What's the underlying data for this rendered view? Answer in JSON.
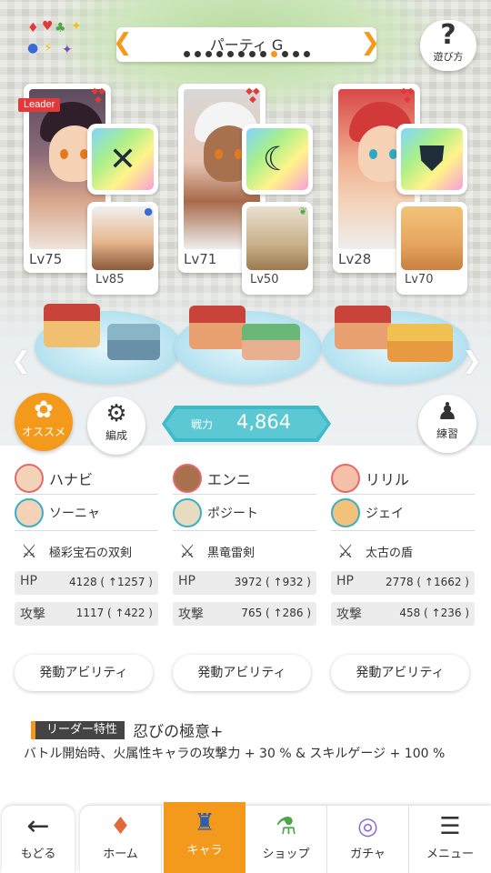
{
  "header": {
    "party_title": "パーティ G",
    "page_dots_total": 12,
    "page_dots_active_index": 8,
    "help_label": "遊び方",
    "suit_icons": [
      "◆",
      "♥",
      "♣",
      "★",
      "●",
      "⚡",
      "✦"
    ]
  },
  "cards": [
    {
      "leader_label": "Leader",
      "main_level": "Lv75",
      "sub_level": "Lv85",
      "weapon_icon": "✕"
    },
    {
      "leader_label": "",
      "main_level": "Lv71",
      "sub_level": "Lv50",
      "weapon_icon": "☾"
    },
    {
      "leader_label": "",
      "main_level": "Lv28",
      "sub_level": "Lv70",
      "weapon_icon": "⛊"
    }
  ],
  "buttons": {
    "recommend_label": "オススメ",
    "formation_label": "編成",
    "practice_label": "練習"
  },
  "power": {
    "label": "戦力",
    "value": "4,864"
  },
  "columns": [
    {
      "main_name": "ハナビ",
      "sub_name": "ソーニャ",
      "weapon_name": "極彩宝石の双剣",
      "hp_label": "HP",
      "hp_value": "4128 ( ↑1257 )",
      "atk_label": "攻撃",
      "atk_value": "1117 ( ↑422 )",
      "ability_label": "発動アビリティ"
    },
    {
      "main_name": "エンニ",
      "sub_name": "ポジート",
      "weapon_name": "黒竜雷剣",
      "hp_label": "HP",
      "hp_value": "3972 ( ↑932 )",
      "atk_label": "攻撃",
      "atk_value": "765 ( ↑286 )",
      "ability_label": "発動アビリティ"
    },
    {
      "main_name": "リリル",
      "sub_name": "ジェイ",
      "weapon_name": "太古の盾",
      "hp_label": "HP",
      "hp_value": "2778 ( ↑1662 )",
      "atk_label": "攻撃",
      "atk_value": "458 ( ↑236 )",
      "ability_label": "発動アビリティ"
    }
  ],
  "leader_skill": {
    "tag": "リーダー特性",
    "name": "忍びの極意+",
    "description": "バトル開始時、火属性キャラの攻撃力 + 30 % & スキルゲージ + 100 %"
  },
  "bottom_nav": {
    "back_label": "もどる",
    "items": [
      {
        "label": "ホーム",
        "icon": "home-icon"
      },
      {
        "label": "キャラ",
        "icon": "character-icon"
      },
      {
        "label": "ショップ",
        "icon": "shop-icon"
      },
      {
        "label": "ガチャ",
        "icon": "gacha-icon"
      },
      {
        "label": "メニュー",
        "icon": "menu-icon"
      }
    ],
    "active_index": 1
  },
  "colors": {
    "accent": "#f39a1c",
    "power_teal": "#40b9c9",
    "diamond_red": "#e03a3a"
  }
}
